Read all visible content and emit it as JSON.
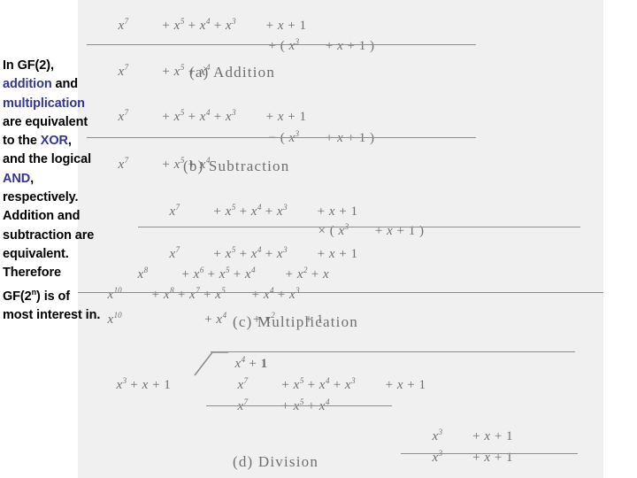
{
  "slide": {
    "background": "#ffffff",
    "figure_background": "#f0f0f0",
    "accent_color": "#333399",
    "math_ink_color": "#6f6f70"
  },
  "body_text": {
    "lines": [
      {
        "text": "In GF(2),",
        "highlight": false
      },
      {
        "text": "addition",
        "highlight": true,
        "suffix": " and"
      },
      {
        "text": "multiplication",
        "highlight": true,
        "suffix": ""
      },
      {
        "text": "are equivalent",
        "highlight": false
      },
      {
        "text": "to the ",
        "highlight": false,
        "kw": "XOR",
        "after": ","
      },
      {
        "text": "and the logical",
        "highlight": false
      },
      {
        "text": "AND",
        "highlight": true,
        "suffix": ","
      },
      {
        "text": "respectively.",
        "highlight": false
      },
      {
        "text": "Addition and",
        "highlight": false
      },
      {
        "text": "subtraction are",
        "highlight": false
      },
      {
        "text": "equivalent.",
        "highlight": false
      },
      {
        "text": "Therefore",
        "highlight": false
      },
      {
        "text": "GF(2n) is of",
        "highlight": false,
        "superscript": "n"
      },
      {
        "text": "most interest in.",
        "highlight": false
      }
    ],
    "full_text": "In GF(2), addition and multiplication are equivalent to the XOR, and the logical AND, respectively. Addition and subtraction are equivalent. Therefore GF(2n) is of most interest in.",
    "keyword_addition": "addition",
    "keyword_multiplication": "multiplication",
    "keyword_xor": "XOR",
    "keyword_and": "AND"
  },
  "figure": {
    "sections": [
      {
        "id": "addition",
        "caption": "(a) Addition",
        "operand1": "x7 + x5 + x4 + x3 + x + 1",
        "operator": "+",
        "operand2": "( x3 + x + 1 )",
        "result": "x7 + x5 + x4"
      },
      {
        "id": "subtraction",
        "caption": "(b) Subtraction",
        "operand1": "x7 + x5 + x4 + x3 + x + 1",
        "operator": "−",
        "operand2": "( x3 + x + 1 )",
        "result": "x7 + x5 + x4"
      },
      {
        "id": "multiplication",
        "caption": "(c) Multiplication",
        "operand1": "x7 + x5 + x4 + x3 + x + 1",
        "operator": "×",
        "operand2": "( x3 + x + 1 )",
        "partial1": "x7 + x5 + x4 + x3 + x + 1",
        "partial2": "x8 + x6 + x5 + x4 + x2 + x",
        "partial3": "x10 + x8 + x7 + x5 + x4 + x3",
        "result": "x10 + x4 + x2 + 1"
      },
      {
        "id": "division",
        "caption": "(d) Division",
        "quotient": "x4 + 1",
        "divisor": "x3 + x + 1",
        "dividend": "x7 + x5 + x4 + x3 + x + 1",
        "subtract1": "x7 + x5 + x4",
        "bring_down": "x3 + x + 1",
        "subtract2": "x3 + x + 1"
      }
    ]
  }
}
